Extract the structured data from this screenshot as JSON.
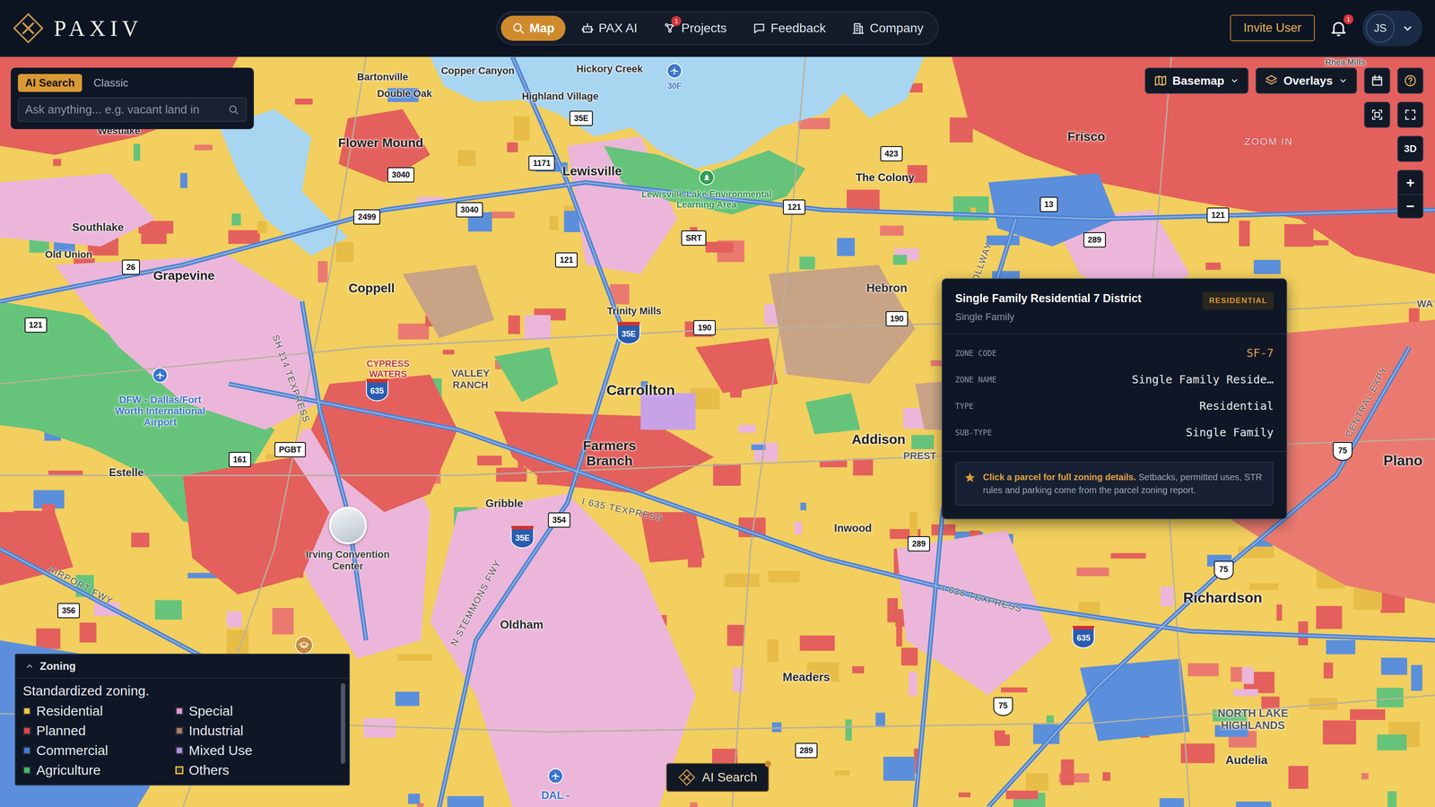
{
  "brand": {
    "name": "PAXIV"
  },
  "nav": [
    {
      "label": "Map",
      "selected": true
    },
    {
      "label": "PAX AI",
      "selected": false
    },
    {
      "label": "Projects",
      "selected": false,
      "badge": "1"
    },
    {
      "label": "Feedback",
      "selected": false
    },
    {
      "label": "Company",
      "selected": false
    }
  ],
  "header": {
    "invite": "Invite User",
    "notifications": "1",
    "avatar": "JS"
  },
  "search": {
    "tabs": [
      {
        "label": "AI Search",
        "selected": true
      },
      {
        "label": "Classic",
        "selected": false
      }
    ],
    "placeholder": "Ask anything... e.g. vacant land in"
  },
  "controls": {
    "basemap": "Basemap",
    "overlays": "Overlays",
    "view3d": "3D",
    "zoom_in": "+",
    "zoom_out": "−",
    "hint": "ZOOM IN"
  },
  "places": [
    {
      "name": "Bartonville",
      "color": "#2b2b2b"
    },
    {
      "name": "Double Oak",
      "color": "#2b2b2b"
    },
    {
      "name": "Copper Canyon",
      "color": "#2b2b2b"
    },
    {
      "name": "Hickory Creek",
      "color": "#2b2b2b"
    },
    {
      "name": "Highland Village",
      "color": "#2b2b2b"
    },
    {
      "name": "Westlake",
      "color": "#2b2b2b"
    },
    {
      "name": "Flower Mound",
      "color": "#1f1f1f"
    },
    {
      "name": "Lewisville",
      "color": "#1f1f1f"
    },
    {
      "name": "Lewisville Lake Environmental Learning Area",
      "color": "#2e8f48"
    },
    {
      "name": "The Colony",
      "color": "#1f1f1f"
    },
    {
      "name": "Frisco",
      "color": "#1f1f1f"
    },
    {
      "name": "Southlake",
      "color": "#2b2b2b"
    },
    {
      "name": "Old Union",
      "color": "#2b2b2b"
    },
    {
      "name": "Grapevine",
      "color": "#1f1f1f"
    },
    {
      "name": "Coppell",
      "color": "#1f1f1f"
    },
    {
      "name": "Hebron",
      "color": "#2b2b2b"
    },
    {
      "name": "Trinity Mills",
      "color": "#2b2b2b"
    },
    {
      "name": "DFW - Dallas/Fort Worth International Airport",
      "color": "#3a74c9"
    },
    {
      "name": "CYPRESS WATERS",
      "color": "#c0392b"
    },
    {
      "name": "VALLEY RANCH",
      "color": "#5a4a3a"
    },
    {
      "name": "Carrollton",
      "color": "#1f1f1f"
    },
    {
      "name": "Farmers Branch",
      "color": "#1f1f1f"
    },
    {
      "name": "Addison",
      "color": "#1f1f1f"
    },
    {
      "name": "Plano",
      "color": "#1f1f1f"
    },
    {
      "name": "Estelle",
      "color": "#2b2b2b"
    },
    {
      "name": "Gribble",
      "color": "#2b2b2b"
    },
    {
      "name": "Irving Convention Center",
      "color": "#3a3a3a"
    },
    {
      "name": "Inwood",
      "color": "#2b2b2b"
    },
    {
      "name": "Oldham",
      "color": "#2b2b2b"
    },
    {
      "name": "Meaders",
      "color": "#2b2b2b"
    },
    {
      "name": "Richardson",
      "color": "#1f1f1f"
    },
    {
      "name": "NORTH LAKE HIGHLANDS",
      "color": "#555555"
    },
    {
      "name": "Audelia",
      "color": "#2b2b2b"
    },
    {
      "name": "PREST",
      "color": "#555555"
    },
    {
      "name": "DAL -",
      "color": "#3a74c9"
    },
    {
      "name": "Rhea Mills",
      "color": "#555555"
    },
    {
      "name": "WA",
      "color": "#555555"
    },
    {
      "name": "30F",
      "color": "#3a74c9"
    }
  ],
  "roads": [
    "SH 114 TEXPRESS",
    "I 635 TEXPRESS",
    "N STEMMONS FWY",
    "DALLAS N TOLLWAY",
    "AIRPORT FWY",
    "I 635 TEXPRESS",
    "CENTRAL EXPY"
  ],
  "shields": [
    {
      "label": "35E",
      "kind": "state"
    },
    {
      "label": "3040",
      "kind": "state"
    },
    {
      "label": "1171",
      "kind": "state"
    },
    {
      "label": "2499",
      "kind": "state"
    },
    {
      "label": "3040",
      "kind": "state"
    },
    {
      "label": "121",
      "kind": "state"
    },
    {
      "label": "SRT",
      "kind": "state"
    },
    {
      "label": "121",
      "kind": "state"
    },
    {
      "label": "423",
      "kind": "state"
    },
    {
      "label": "13",
      "kind": "state"
    },
    {
      "label": "289",
      "kind": "state"
    },
    {
      "label": "121",
      "kind": "state"
    },
    {
      "label": "26",
      "kind": "state"
    },
    {
      "label": "121",
      "kind": "state"
    },
    {
      "label": "190",
      "kind": "state"
    },
    {
      "label": "190",
      "kind": "state"
    },
    {
      "label": "35E",
      "kind": "interstate"
    },
    {
      "label": "635",
      "kind": "interstate"
    },
    {
      "label": "PGBT",
      "kind": "state"
    },
    {
      "label": "161",
      "kind": "state"
    },
    {
      "label": "354",
      "kind": "state"
    },
    {
      "label": "35E",
      "kind": "interstate"
    },
    {
      "label": "289",
      "kind": "state"
    },
    {
      "label": "75",
      "kind": "us"
    },
    {
      "label": "75",
      "kind": "us"
    },
    {
      "label": "635",
      "kind": "interstate"
    },
    {
      "label": "75",
      "kind": "us"
    },
    {
      "label": "356",
      "kind": "state"
    },
    {
      "label": "289",
      "kind": "state"
    }
  ],
  "popup": {
    "title": "Single Family Residential 7 District",
    "badge": "RESIDENTIAL",
    "subtitle": "Single Family",
    "rows": [
      {
        "label": "ZONE CODE",
        "value": "SF-7",
        "accent": true
      },
      {
        "label": "ZONE NAME",
        "value": "Single Family Reside…",
        "accent": false
      },
      {
        "label": "TYPE",
        "value": "Residential",
        "accent": false
      },
      {
        "label": "SUB-TYPE",
        "value": "Single Family",
        "accent": false
      }
    ],
    "note": {
      "lead": "Click a parcel for full zoning details.",
      "text": "Setbacks, permitted uses, STR rules and parking come from the parcel zoning report."
    }
  },
  "legend": {
    "title": "Zoning",
    "description": "Standardized zoning.",
    "items": [
      {
        "label": "Residential",
        "color": "#f0c93c",
        "outlined": false
      },
      {
        "label": "Planned",
        "color": "#e3474b",
        "outlined": false
      },
      {
        "label": "Commercial",
        "color": "#3f7fdc",
        "outlined": false
      },
      {
        "label": "Agriculture",
        "color": "#3fbf62",
        "outlined": false
      },
      {
        "label": "Special",
        "color": "#e69ad8",
        "outlined": false
      },
      {
        "label": "Industrial",
        "color": "#a9806d",
        "outlined": false
      },
      {
        "label": "Mixed Use",
        "color": "#b88ee6",
        "outlined": false
      },
      {
        "label": "Others",
        "color": "#e8b93a",
        "outlined": true
      }
    ]
  },
  "ai_button": "AI Search"
}
